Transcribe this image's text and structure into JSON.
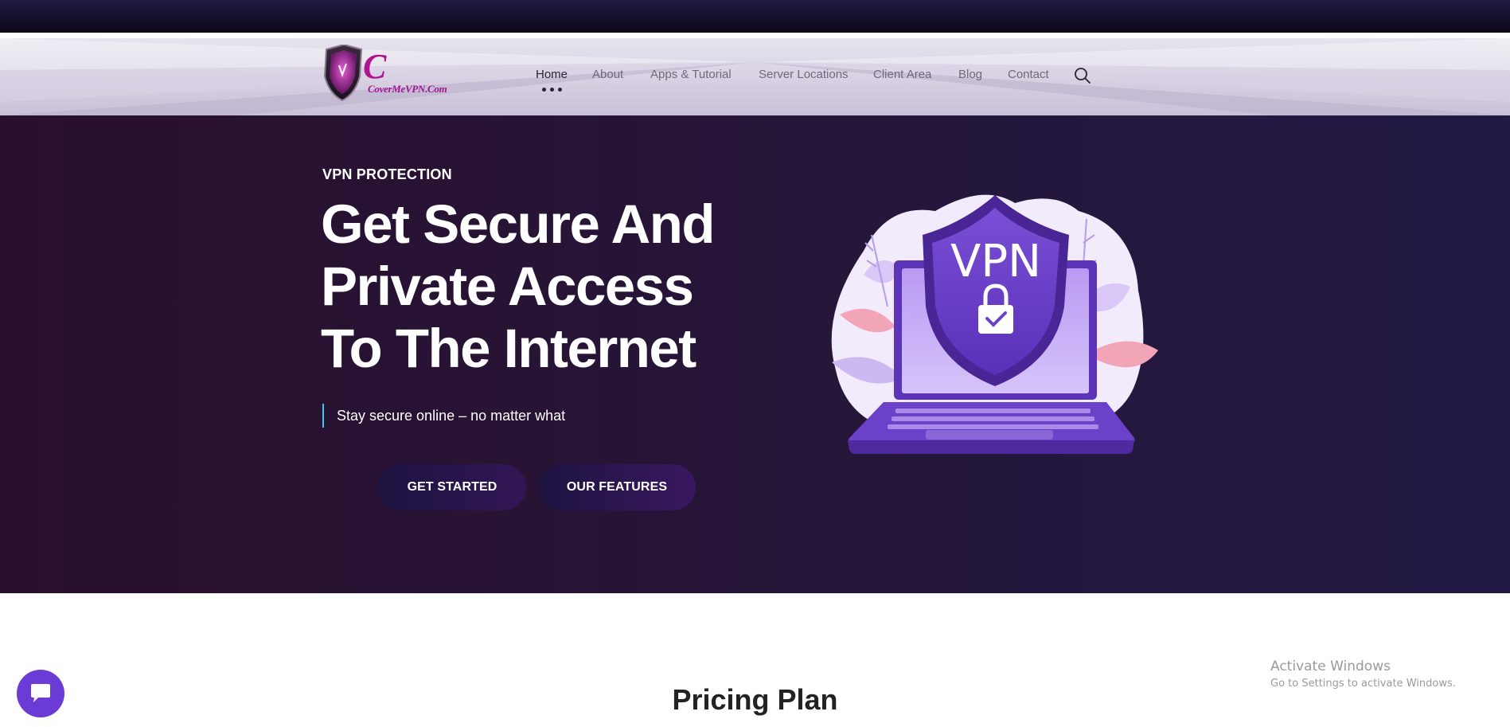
{
  "brand": {
    "logo_text": "CoverMeVPN.Com",
    "logo_letter": "C"
  },
  "nav": {
    "items": [
      {
        "label": "Home",
        "active": true
      },
      {
        "label": "About"
      },
      {
        "label": "Apps & Tutorial"
      },
      {
        "label": "Server Locations"
      },
      {
        "label": "Client Area"
      },
      {
        "label": "Blog"
      },
      {
        "label": "Contact"
      }
    ],
    "search_icon": "search-icon"
  },
  "hero": {
    "eyebrow": "VPN PROTECTION",
    "headline": [
      "Get Secure And",
      "Private Access",
      "To The Internet"
    ],
    "tagline": "Stay secure online – no matter what",
    "buttons": {
      "primary": "GET STARTED",
      "secondary": "OUR FEATURES"
    },
    "illustration": {
      "shield_text": "VPN"
    }
  },
  "pricing": {
    "title": "Pricing Plan"
  },
  "chat": {
    "icon": "chat-bubble-icon"
  },
  "watermark": {
    "title": "Activate Windows",
    "subtitle": "Go to Settings to activate Windows."
  },
  "colors": {
    "hero_bg": "#261537",
    "accent": "#6c3bd6",
    "tagline_bar": "#3fc6e8",
    "brand_magenta": "#b0138f"
  }
}
